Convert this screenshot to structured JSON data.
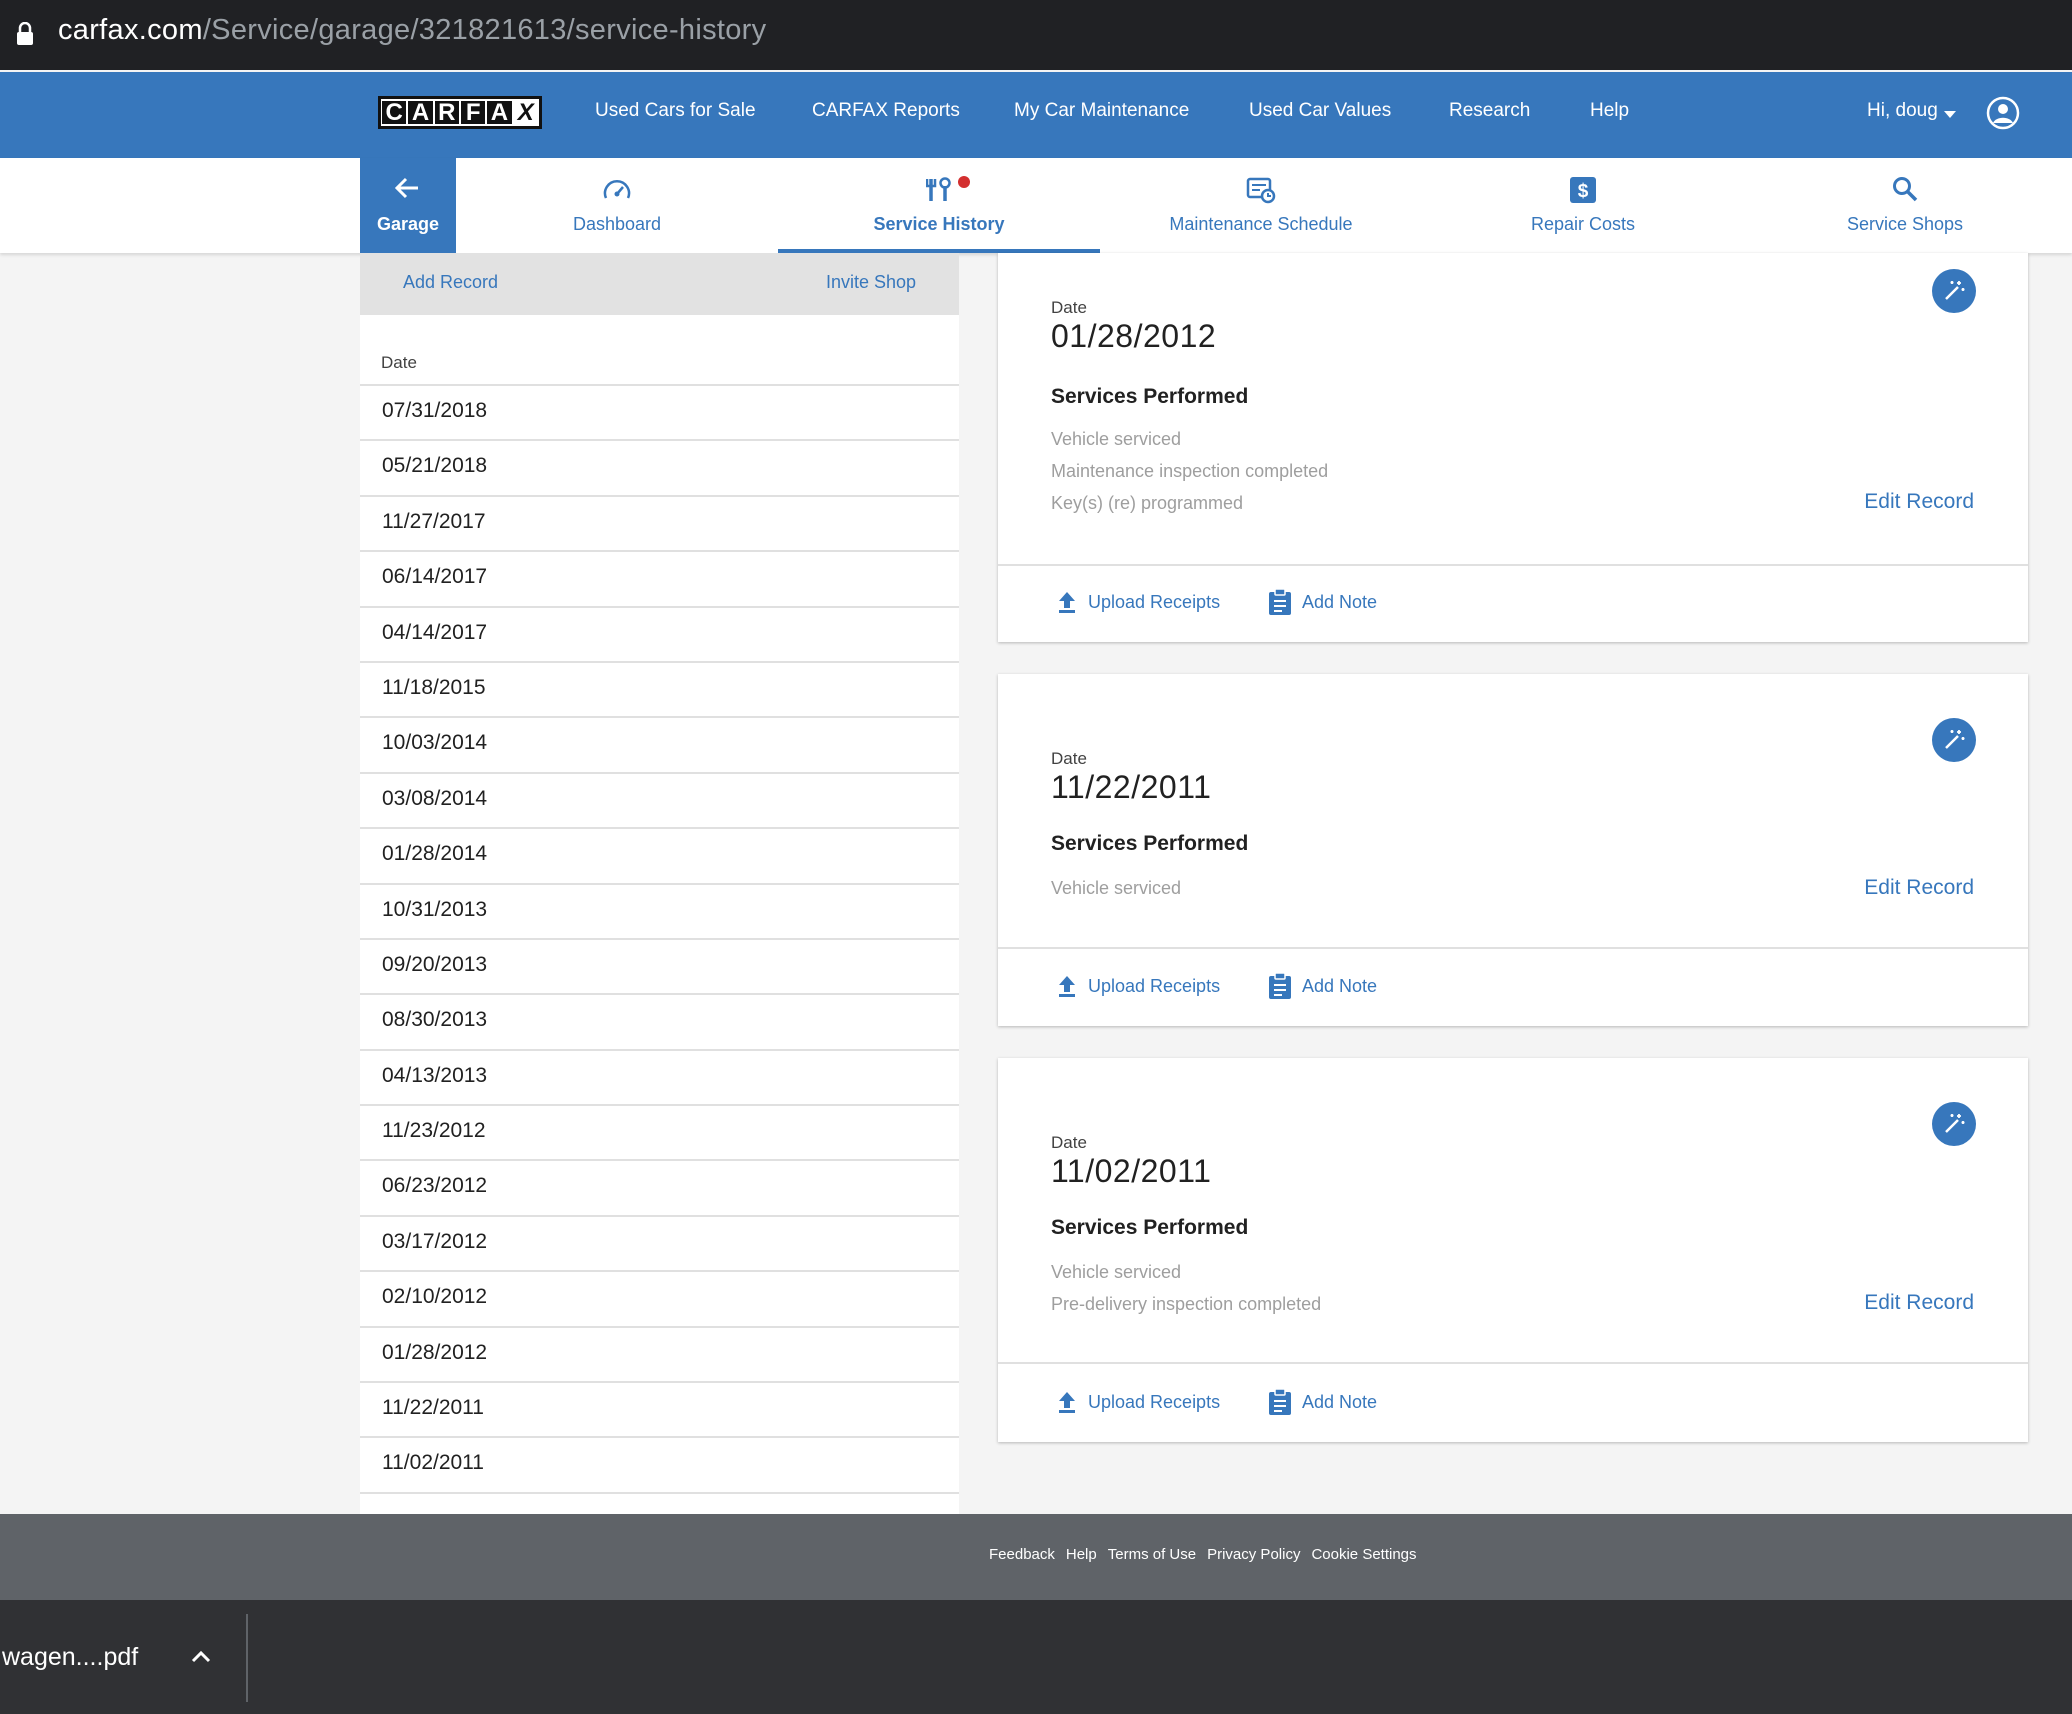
{
  "browser": {
    "url_domain": "carfax.com",
    "url_path": "/Service/garage/321821613/service-history"
  },
  "topnav": {
    "logo": "CARFAX",
    "links": [
      "Used Cars for Sale",
      "CARFAX Reports",
      "My Car Maintenance",
      "Used Car Values",
      "Research",
      "Help"
    ],
    "user_greeting": "Hi, doug",
    "accent_color": "#3777bc"
  },
  "subnav": {
    "back_label": "Garage",
    "tabs": [
      {
        "label": "Dashboard",
        "icon": "speedometer-icon"
      },
      {
        "label": "Service History",
        "icon": "tools-icon",
        "active": true,
        "has_notification": true
      },
      {
        "label": "Maintenance Schedule",
        "icon": "schedule-icon"
      },
      {
        "label": "Repair Costs",
        "icon": "dollar-icon"
      },
      {
        "label": "Service Shops",
        "icon": "search-icon"
      }
    ]
  },
  "left": {
    "add_record": "Add Record",
    "invite_shop": "Invite Shop",
    "date_header": "Date",
    "dates": [
      "07/31/2018",
      "05/21/2018",
      "11/27/2017",
      "06/14/2017",
      "04/14/2017",
      "11/18/2015",
      "10/03/2014",
      "03/08/2014",
      "01/28/2014",
      "10/31/2013",
      "09/20/2013",
      "08/30/2013",
      "04/13/2013",
      "11/23/2012",
      "06/23/2012",
      "03/17/2012",
      "02/10/2012",
      "01/28/2012",
      "11/22/2011",
      "11/02/2011"
    ]
  },
  "records": [
    {
      "date_label": "Date",
      "date": "01/28/2012",
      "services_label": "Services Performed",
      "services": [
        "Vehicle serviced",
        "Maintenance inspection completed",
        "Key(s) (re) programmed"
      ],
      "edit": "Edit Record",
      "upload": "Upload Receipts",
      "note": "Add Note"
    },
    {
      "date_label": "Date",
      "date": "11/22/2011",
      "services_label": "Services Performed",
      "services": [
        "Vehicle serviced"
      ],
      "edit": "Edit Record",
      "upload": "Upload Receipts",
      "note": "Add Note"
    },
    {
      "date_label": "Date",
      "date": "11/02/2011",
      "services_label": "Services Performed",
      "services": [
        "Vehicle serviced",
        "Pre-delivery inspection completed"
      ],
      "edit": "Edit Record",
      "upload": "Upload Receipts",
      "note": "Add Note"
    }
  ],
  "footer": {
    "links": [
      "Feedback",
      "Help",
      "Terms of Use",
      "Privacy Policy",
      "Cookie Settings"
    ]
  },
  "download": {
    "filename": "wagen....pdf"
  }
}
